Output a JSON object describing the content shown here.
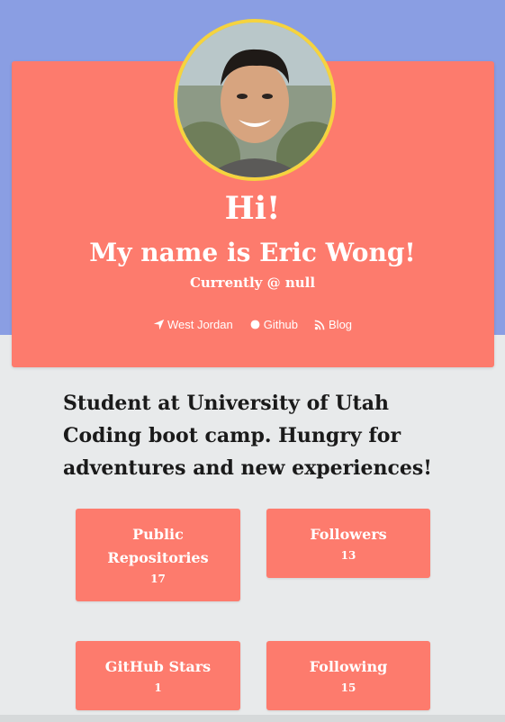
{
  "profile": {
    "greeting": "Hi!",
    "name_line": "My name is Eric Wong!",
    "status": "Currently @ null",
    "avatar_alt": "Eric Wong profile photo"
  },
  "links": [
    {
      "label": "West Jordan",
      "icon": "location-arrow-icon"
    },
    {
      "label": "Github",
      "icon": "github-icon"
    },
    {
      "label": "Blog",
      "icon": "rss-icon"
    }
  ],
  "bio": "Student at University of Utah Coding boot camp. Hungry for adventures and new experiences!",
  "stats": {
    "public_repos": {
      "label": "Public Repositories",
      "value": "17"
    },
    "followers": {
      "label": "Followers",
      "value": "13"
    },
    "stars": {
      "label": "GitHub Stars",
      "value": "1"
    },
    "following": {
      "label": "Following",
      "value": "15"
    }
  },
  "colors": {
    "top_band": "#8a9ee3",
    "card": "#fd7b6d",
    "avatar_border": "#f5d33f",
    "page_bg": "#e8eaeb"
  }
}
